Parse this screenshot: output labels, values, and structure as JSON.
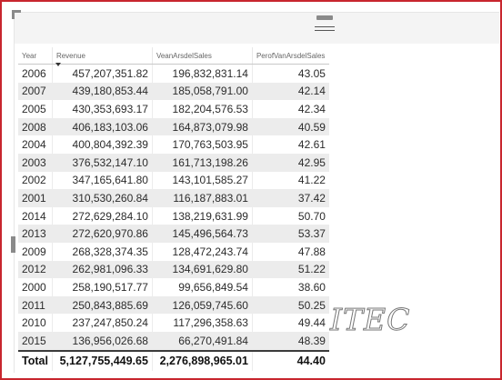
{
  "table": {
    "columns": [
      "Year",
      "Revenue",
      "VeanArsdelSales",
      "PerofVanArsdelSales"
    ],
    "rows": [
      [
        "2006",
        "457,207,351.82",
        "196,832,831.14",
        "43.05"
      ],
      [
        "2007",
        "439,180,853.44",
        "185,058,791.00",
        "42.14"
      ],
      [
        "2005",
        "430,353,693.17",
        "182,204,576.53",
        "42.34"
      ],
      [
        "2008",
        "406,183,103.06",
        "164,873,079.98",
        "40.59"
      ],
      [
        "2004",
        "400,804,392.39",
        "170,763,503.95",
        "42.61"
      ],
      [
        "2003",
        "376,532,147.10",
        "161,713,198.26",
        "42.95"
      ],
      [
        "2002",
        "347,165,641.80",
        "143,101,585.27",
        "41.22"
      ],
      [
        "2001",
        "310,530,260.84",
        "116,187,883.01",
        "37.42"
      ],
      [
        "2014",
        "272,629,284.10",
        "138,219,631.99",
        "50.70"
      ],
      [
        "2013",
        "272,620,970.86",
        "145,496,564.73",
        "53.37"
      ],
      [
        "2009",
        "268,328,374.35",
        "128,472,243.74",
        "47.88"
      ],
      [
        "2012",
        "262,981,096.33",
        "134,691,629.80",
        "51.22"
      ],
      [
        "2000",
        "258,190,517.77",
        "99,656,849.54",
        "38.60"
      ],
      [
        "2011",
        "250,843,885.69",
        "126,059,745.60",
        "50.25"
      ],
      [
        "2010",
        "237,247,850.24",
        "117,296,358.63",
        "49.44"
      ],
      [
        "2015",
        "136,956,026.68",
        "66,270,491.84",
        "48.39"
      ]
    ],
    "total": [
      "Total",
      "5,127,755,449.65",
      "2,276,898,965.01",
      "44.40"
    ]
  },
  "watermark": "ITEC",
  "colors": {
    "frame": "#c8262e",
    "band": "#ececec"
  },
  "sort": {
    "column": "Revenue",
    "direction": "descending"
  }
}
